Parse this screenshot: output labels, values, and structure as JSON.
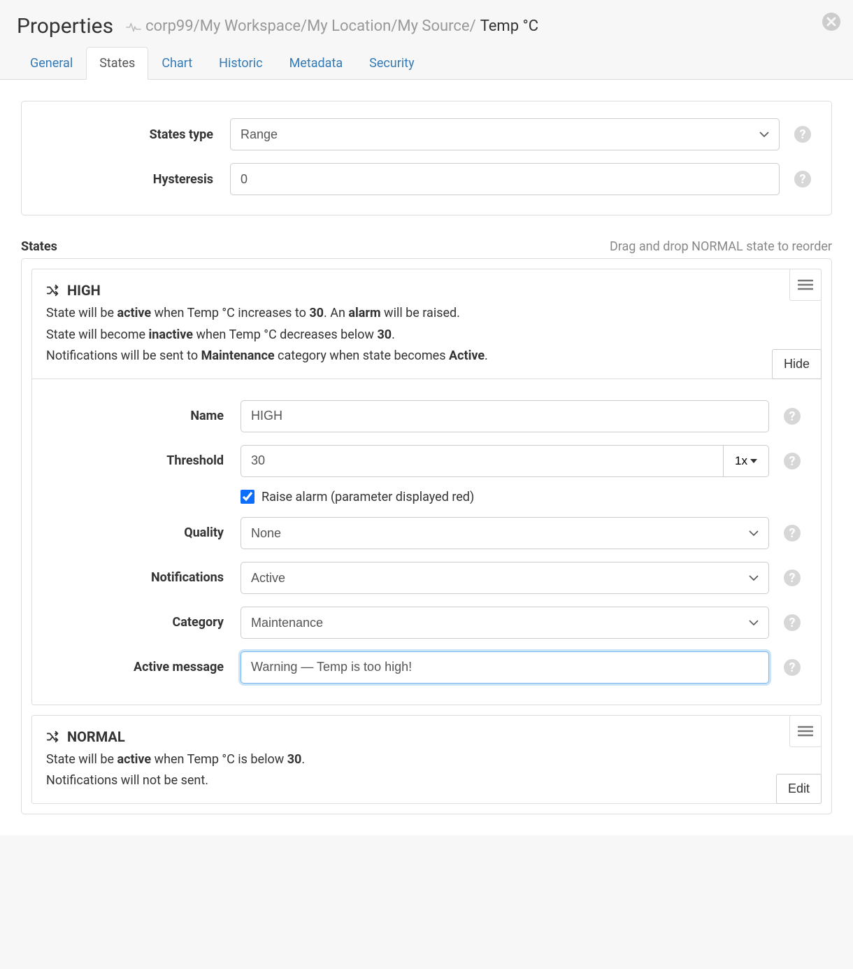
{
  "header": {
    "title": "Properties",
    "breadcrumb_muted": "corp99/My Workspace/My Location/My Source/",
    "breadcrumb_active": "Temp °C"
  },
  "tabs": [
    "General",
    "States",
    "Chart",
    "Historic",
    "Metadata",
    "Security"
  ],
  "activeTab": "States",
  "config": {
    "states_type_label": "States type",
    "states_type_value": "Range",
    "hysteresis_label": "Hysteresis",
    "hysteresis_value": "0"
  },
  "section": {
    "title": "States",
    "hint": "Drag and drop NORMAL state to reorder"
  },
  "state_high": {
    "title": "HIGH",
    "desc1_pre": "State will be ",
    "desc1_b1": "active",
    "desc1_mid": " when Temp °C increases to ",
    "desc1_b2": "30",
    "desc1_post": ". An ",
    "desc1_b3": "alarm",
    "desc1_end": " will be raised.",
    "desc2_pre": "State will become ",
    "desc2_b1": "inactive",
    "desc2_mid": " when Temp °C decreases below ",
    "desc2_b2": "30",
    "desc2_end": ".",
    "desc3_pre": "Notifications will be sent to ",
    "desc3_b1": "Maintenance",
    "desc3_mid": " category when state becomes ",
    "desc3_b2": "Active",
    "desc3_end": ".",
    "hide_btn": "Hide",
    "form": {
      "name_label": "Name",
      "name_value": "HIGH",
      "threshold_label": "Threshold",
      "threshold_value": "30",
      "threshold_mult": "1x",
      "raise_alarm_label": "Raise alarm (parameter displayed red)",
      "raise_alarm_checked": true,
      "quality_label": "Quality",
      "quality_value": "None",
      "notifications_label": "Notifications",
      "notifications_value": "Active",
      "category_label": "Category",
      "category_value": "Maintenance",
      "active_message_label": "Active message",
      "active_message_value": "Warning — Temp is too high!"
    }
  },
  "state_normal": {
    "title": "NORMAL",
    "desc1_pre": "State will be ",
    "desc1_b1": "active",
    "desc1_mid": " when Temp °C is below ",
    "desc1_b2": "30",
    "desc1_end": ".",
    "desc2": "Notifications will not be sent.",
    "edit_btn": "Edit"
  }
}
